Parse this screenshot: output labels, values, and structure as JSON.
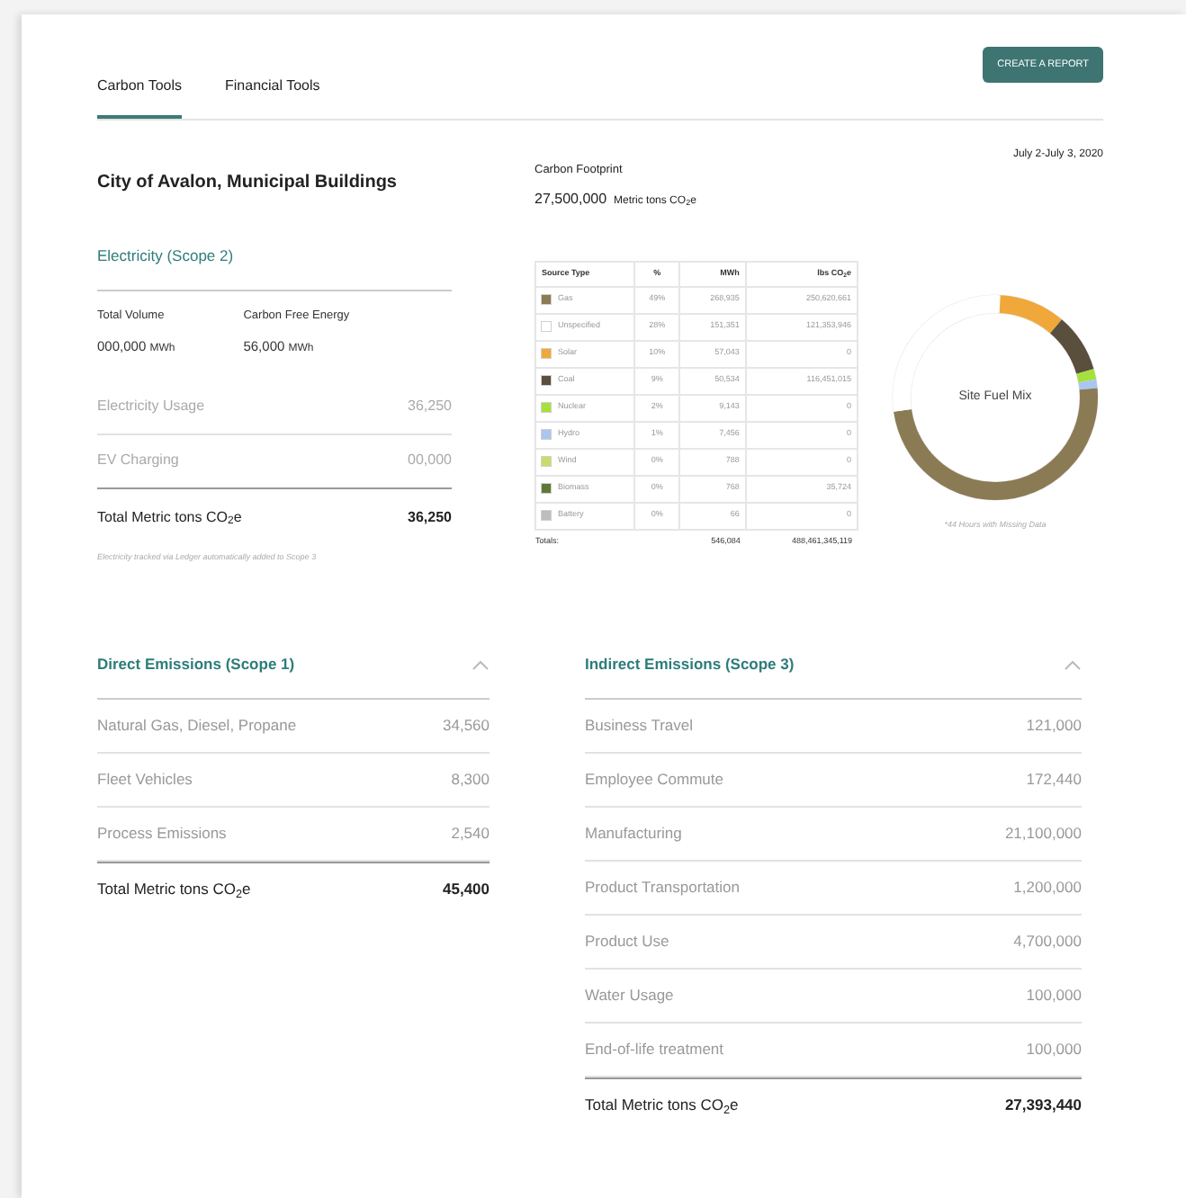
{
  "tabs": [
    {
      "label": "Carbon Tools",
      "selected": true
    },
    {
      "label": "Financial Tools",
      "selected": false
    }
  ],
  "create_button": "CREATE A REPORT",
  "site_title": "City of Avalon, Municipal Buildings",
  "footprint": {
    "label": "Carbon Footprint",
    "value": "27,500,000",
    "unit": "Metric tons CO$_{2}$e"
  },
  "date_range": "July 2-July 3, 2020",
  "electricity": {
    "heading": "Electricity (Scope 2)",
    "stats": [
      {
        "label": "Total Volume",
        "value": "000,000",
        "unit": "MWh"
      },
      {
        "label": "Carbon Free Energy",
        "value": "56,000",
        "unit": "MWh"
      }
    ],
    "rows": [
      {
        "label": "Electricity Usage",
        "value": "36,250"
      },
      {
        "label": "EV Charging",
        "value": "00,000"
      }
    ],
    "total": {
      "label": "Total Metric tons CO$_{2}$e",
      "value": "36,250"
    },
    "note": "Electricity tracked via Ledger automatically added to Scope 3"
  },
  "fuel_table": {
    "columns": [
      "Source Type",
      "%",
      "MWh",
      "lbs CO$_{2}$e"
    ],
    "rows": [
      {
        "source": "Gas",
        "color": "#8b7b55",
        "pct": "49%",
        "mwh": "268,935",
        "lbs": "250,620,661"
      },
      {
        "source": "Unspecified",
        "color": "#ffffff",
        "pct": "28%",
        "mwh": "151,351",
        "lbs": "121,353,946"
      },
      {
        "source": "Solar",
        "color": "#f0a83a",
        "pct": "10%",
        "mwh": "57,043",
        "lbs": "0"
      },
      {
        "source": "Coal",
        "color": "#5a4e3c",
        "pct": "9%",
        "mwh": "50,534",
        "lbs": "116,451,015"
      },
      {
        "source": "Nuclear",
        "color": "#a6e03c",
        "pct": "2%",
        "mwh": "9,143",
        "lbs": "0"
      },
      {
        "source": "Hydro",
        "color": "#a9c6f0",
        "pct": "1%",
        "mwh": "7,456",
        "lbs": "0"
      },
      {
        "source": "Wind",
        "color": "#c9dc6a",
        "pct": "0%",
        "mwh": "788",
        "lbs": "0"
      },
      {
        "source": "Biomass",
        "color": "#5f7a34",
        "pct": "0%",
        "mwh": "768",
        "lbs": "35,724"
      },
      {
        "source": "Battery",
        "color": "#bdbdbd",
        "pct": "0%",
        "mwh": "66",
        "lbs": "0"
      }
    ],
    "totals": {
      "label": "Totals:",
      "mwh": "546,084",
      "lbs": "488,461,345,119"
    }
  },
  "fuel_mix": {
    "label": "Site Fuel Mix",
    "note": "*44 Hours with Missing Data"
  },
  "direct": {
    "heading": "Direct Emissions (Scope 1)",
    "expanded": true,
    "rows": [
      {
        "label": "Natural Gas, Diesel, Propane",
        "value": "34,560"
      },
      {
        "label": "Fleet Vehicles",
        "value": "8,300"
      },
      {
        "label": "Process Emissions",
        "value": "2,540"
      }
    ],
    "total": {
      "label": "Total Metric tons CO$_{2}$e",
      "value": "45,400"
    }
  },
  "indirect": {
    "heading": "Indirect Emissions (Scope 3)",
    "expanded": true,
    "rows": [
      {
        "label": "Business Travel",
        "value": "121,000"
      },
      {
        "label": "Employee Commute",
        "value": "172,440"
      },
      {
        "label": "Manufacturing",
        "value": "21,100,000"
      },
      {
        "label": "Product Transportation",
        "value": "1,200,000"
      },
      {
        "label": "Product Use",
        "value": "4,700,000"
      },
      {
        "label": "Water Usage",
        "value": "100,000"
      },
      {
        "label": "End-of-life treatment",
        "value": "100,000"
      }
    ],
    "total": {
      "label": "Total Metric tons CO$_{2}$e",
      "value": "27,393,440"
    }
  }
}
